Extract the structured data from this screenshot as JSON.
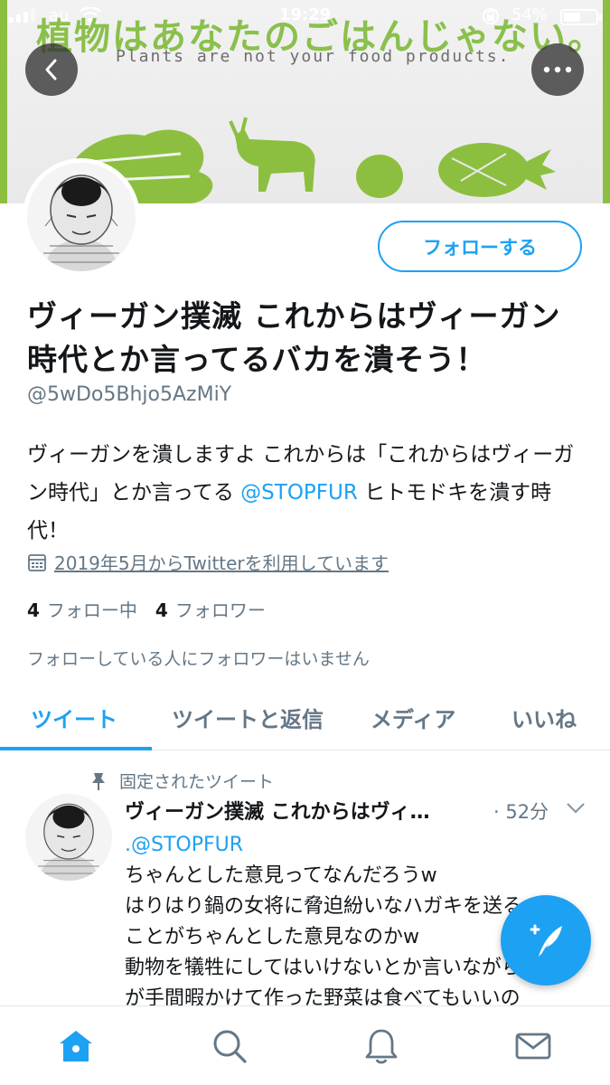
{
  "status_bar": {
    "carrier": "au",
    "time": "19:29",
    "battery_percent_text": "54%",
    "battery_level": 0.54
  },
  "banner": {
    "title": "植物はあなたのごはんじゃない。",
    "subtitle": "Plants are not your food products.",
    "accent_color": "#8cbf3f"
  },
  "header": {
    "back_icon": "back-arrow-icon",
    "more_icon": "more-dots-icon"
  },
  "profile": {
    "follow_label": "フォローする",
    "display_name": "ヴィーガン撲滅 これからはヴィーガン時代とか言ってるバカを潰そう！",
    "handle": "@5wDo5Bhjo5AzMiY",
    "bio_before": "ヴィーガンを潰しますよ これからは「これからはヴィーガン時代」とか言ってる ",
    "bio_mention": "@STOPFUR",
    "bio_after": " ヒトモドキを潰す時代！",
    "joined": "2019年5月からTwitterを利用しています",
    "following_count": "4",
    "following_label": "フォロー中",
    "followers_count": "4",
    "followers_label": "フォロワー",
    "followed_note": "フォローしている人にフォロワーはいません"
  },
  "tabs": [
    {
      "label": "ツイート",
      "active": true
    },
    {
      "label": "ツイートと返信",
      "active": false
    },
    {
      "label": "メディア",
      "active": false
    },
    {
      "label": "いいね",
      "active": false
    }
  ],
  "pinned_tweet": {
    "pinned_label": "固定されたツイート",
    "author": "ヴィーガン撲滅 これからはヴィ…",
    "time": "· 52分",
    "mention_line": ".@STOPFUR",
    "lines": [
      "ちゃんとした意見ってなんだろうw",
      "はりはり鍋の女将に脅迫紛いなハガキを送る",
      "ことがちゃんとした意見なのかw",
      "動物を犠牲にしてはいけないとか言いながら",
      "が手間暇かけて作った野菜は食べてもいいの"
    ]
  },
  "colors": {
    "brand": "#1da1f2",
    "text": "#14171a",
    "secondary": "#657786"
  },
  "bottom_nav": [
    "home-icon",
    "search-icon",
    "notifications-icon",
    "messages-icon"
  ]
}
